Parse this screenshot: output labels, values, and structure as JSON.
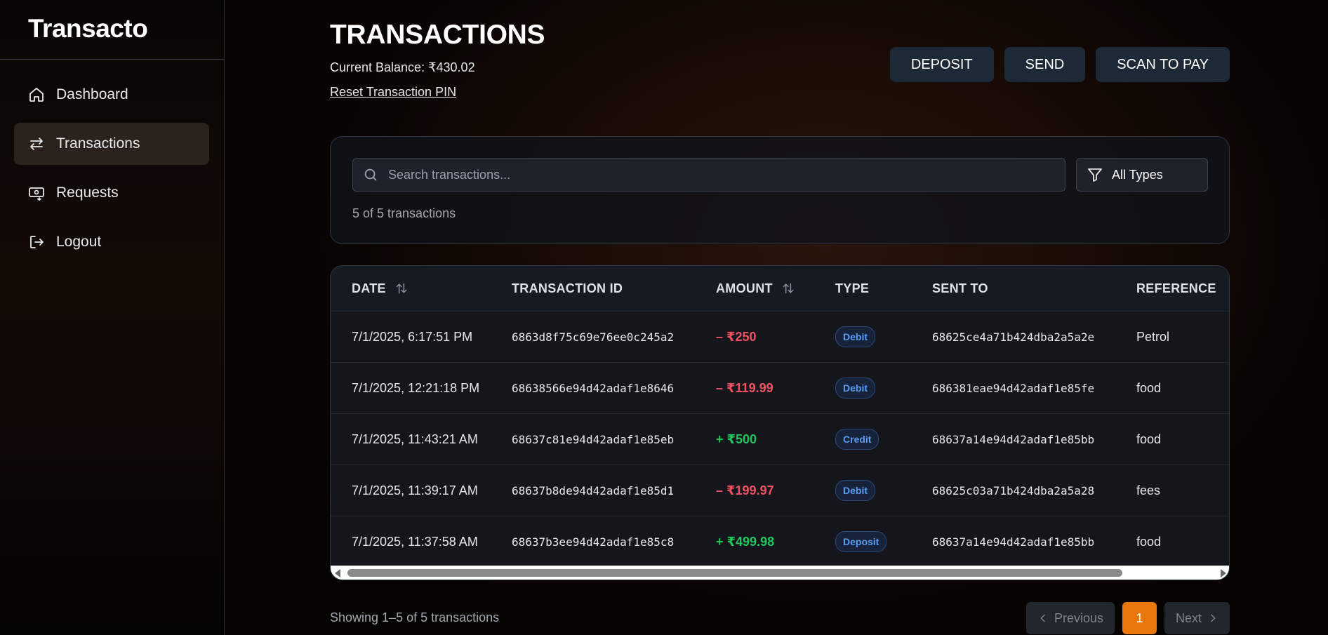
{
  "brand": "Transacto",
  "nav": [
    {
      "label": "Dashboard",
      "icon": "home-icon",
      "active": false
    },
    {
      "label": "Transactions",
      "icon": "arrows-exchange-icon",
      "active": true
    },
    {
      "label": "Requests",
      "icon": "money-request-icon",
      "active": false
    },
    {
      "label": "Logout",
      "icon": "logout-icon",
      "active": false
    }
  ],
  "header": {
    "title": "TRANSACTIONS",
    "balance": "Current Balance: ₹430.02",
    "reset_pin": "Reset Transaction PIN"
  },
  "actions": {
    "deposit": "DEPOSIT",
    "send": "SEND",
    "scan": "SCAN TO PAY"
  },
  "filters": {
    "search_placeholder": "Search transactions...",
    "type_select": "All Types",
    "count": "5 of 5 transactions"
  },
  "table": {
    "headers": [
      "DATE",
      "TRANSACTION ID",
      "AMOUNT",
      "TYPE",
      "SENT TO",
      "REFERENCE"
    ],
    "rows": [
      {
        "date": "7/1/2025, 6:17:51 PM",
        "id": "6863d8f75c69e76ee0c245a2",
        "amount": "– ₹250",
        "direction": "debit",
        "type": "Debit",
        "sent_to": "68625ce4a71b424dba2a5a2e",
        "reference": "Petrol"
      },
      {
        "date": "7/1/2025, 12:21:18 PM",
        "id": "68638566e94d42adaf1e8646",
        "amount": "– ₹119.99",
        "direction": "debit",
        "type": "Debit",
        "sent_to": "686381eae94d42adaf1e85fe",
        "reference": "food"
      },
      {
        "date": "7/1/2025, 11:43:21 AM",
        "id": "68637c81e94d42adaf1e85eb",
        "amount": "+ ₹500",
        "direction": "credit",
        "type": "Credit",
        "sent_to": "68637a14e94d42adaf1e85bb",
        "reference": "food"
      },
      {
        "date": "7/1/2025, 11:39:17 AM",
        "id": "68637b8de94d42adaf1e85d1",
        "amount": "– ₹199.97",
        "direction": "debit",
        "type": "Debit",
        "sent_to": "68625c03a71b424dba2a5a28",
        "reference": "fees"
      },
      {
        "date": "7/1/2025, 11:37:58 AM",
        "id": "68637b3ee94d42adaf1e85c8",
        "amount": "+ ₹499.98",
        "direction": "credit",
        "type": "Deposit",
        "sent_to": "68637a14e94d42adaf1e85bb",
        "reference": "food"
      }
    ]
  },
  "footer": {
    "showing": "Showing 1–5 of 5 transactions",
    "prev": "Previous",
    "page": "1",
    "next": "Next"
  },
  "colors": {
    "accent": "#e8770e",
    "debit": "#f05263",
    "credit": "#22c55e",
    "badge": "#5b9cf5"
  }
}
